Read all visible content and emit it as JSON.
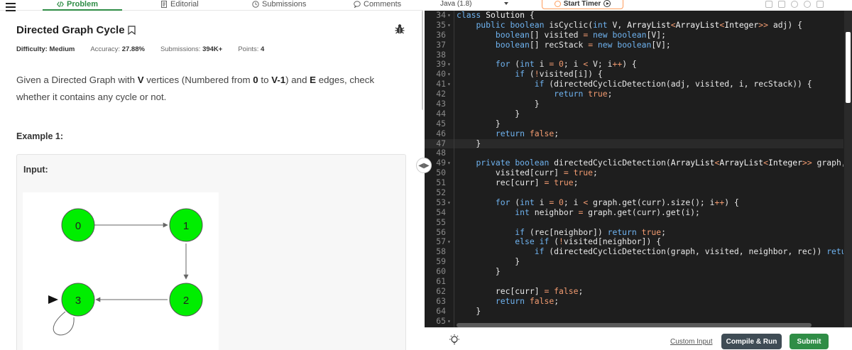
{
  "nav": {
    "tabs": [
      {
        "label": "Problem",
        "icon": "code-icon"
      },
      {
        "label": "Editorial",
        "icon": "document-icon"
      },
      {
        "label": "Submissions",
        "icon": "clock-icon"
      },
      {
        "label": "Comments",
        "icon": "chat-icon"
      }
    ]
  },
  "problem": {
    "title": "Directed Graph Cycle",
    "meta": {
      "difficulty_label": "Difficulty:",
      "difficulty": "Medium",
      "accuracy_label": "Accuracy:",
      "accuracy": "27.88%",
      "submissions_label": "Submissions:",
      "submissions": "394K+",
      "points_label": "Points:",
      "points": "4"
    },
    "desc": {
      "p1": "Given a Directed Graph with ",
      "b1": "V",
      "p2": " vertices (Numbered from ",
      "b2": "0",
      "p3": " to ",
      "b3": "V-1",
      "p4": ") and ",
      "b4": "E",
      "p5": " edges, check whether it contains any cycle or not."
    },
    "example_heading": "Example 1:",
    "input_label": "Input:",
    "graph": {
      "nodes": [
        "0",
        "1",
        "2",
        "3"
      ],
      "node_color": "#00ee00"
    }
  },
  "editor": {
    "language": "Java (1.8)",
    "timer_label": "Start Timer",
    "custom_input": "Custom Input",
    "compile_run": "Compile & Run",
    "submit": "Submit",
    "lines": [
      {
        "n": "34",
        "fold": true
      },
      {
        "n": "35",
        "fold": true
      },
      {
        "n": "36",
        "fold": false
      },
      {
        "n": "37",
        "fold": false
      },
      {
        "n": "38",
        "fold": false
      },
      {
        "n": "39",
        "fold": true
      },
      {
        "n": "40",
        "fold": true
      },
      {
        "n": "41",
        "fold": true
      },
      {
        "n": "42",
        "fold": false
      },
      {
        "n": "43",
        "fold": false
      },
      {
        "n": "44",
        "fold": false
      },
      {
        "n": "45",
        "fold": false
      },
      {
        "n": "46",
        "fold": false
      },
      {
        "n": "47",
        "fold": false
      },
      {
        "n": "48",
        "fold": false
      },
      {
        "n": "49",
        "fold": true
      },
      {
        "n": "50",
        "fold": false
      },
      {
        "n": "51",
        "fold": false
      },
      {
        "n": "52",
        "fold": false
      },
      {
        "n": "53",
        "fold": true
      },
      {
        "n": "54",
        "fold": false
      },
      {
        "n": "55",
        "fold": false
      },
      {
        "n": "56",
        "fold": false
      },
      {
        "n": "57",
        "fold": true
      },
      {
        "n": "58",
        "fold": false
      },
      {
        "n": "59",
        "fold": false
      },
      {
        "n": "60",
        "fold": false
      },
      {
        "n": "61",
        "fold": false
      },
      {
        "n": "62",
        "fold": false
      },
      {
        "n": "63",
        "fold": false
      },
      {
        "n": "64",
        "fold": false
      },
      {
        "n": "65",
        "fold": true
      }
    ],
    "code": [
      "class Solution {",
      "    public boolean isCyclic(int V, ArrayList<ArrayList<Integer>> adj) {",
      "        boolean[] visited = new boolean[V];",
      "        boolean[] recStack = new boolean[V];",
      "",
      "        for (int i = 0; i < V; i++) {",
      "            if (!visited[i]) {",
      "                if (directedCyclicDetection(adj, visited, i, recStack)) {",
      "                    return true;",
      "                }",
      "            }",
      "        }",
      "        return false;",
      "    }",
      "",
      "    private boolean directedCyclicDetection(ArrayList<ArrayList<Integer>> graph, boolean[] visited, int curr, boolean[] rec) {",
      "        visited[curr] = true;",
      "        rec[curr] = true;",
      "",
      "        for (int i = 0; i < graph.get(curr).size(); i++) {",
      "            int neighbor = graph.get(curr).get(i);",
      "",
      "            if (rec[neighbor]) return true;",
      "            else if (!visited[neighbor]) {",
      "                if (directedCyclicDetection(graph, visited, neighbor, rec)) return true;",
      "            }",
      "        }",
      "",
      "        rec[curr] = false;",
      "        return false;",
      "    }",
      ""
    ]
  }
}
